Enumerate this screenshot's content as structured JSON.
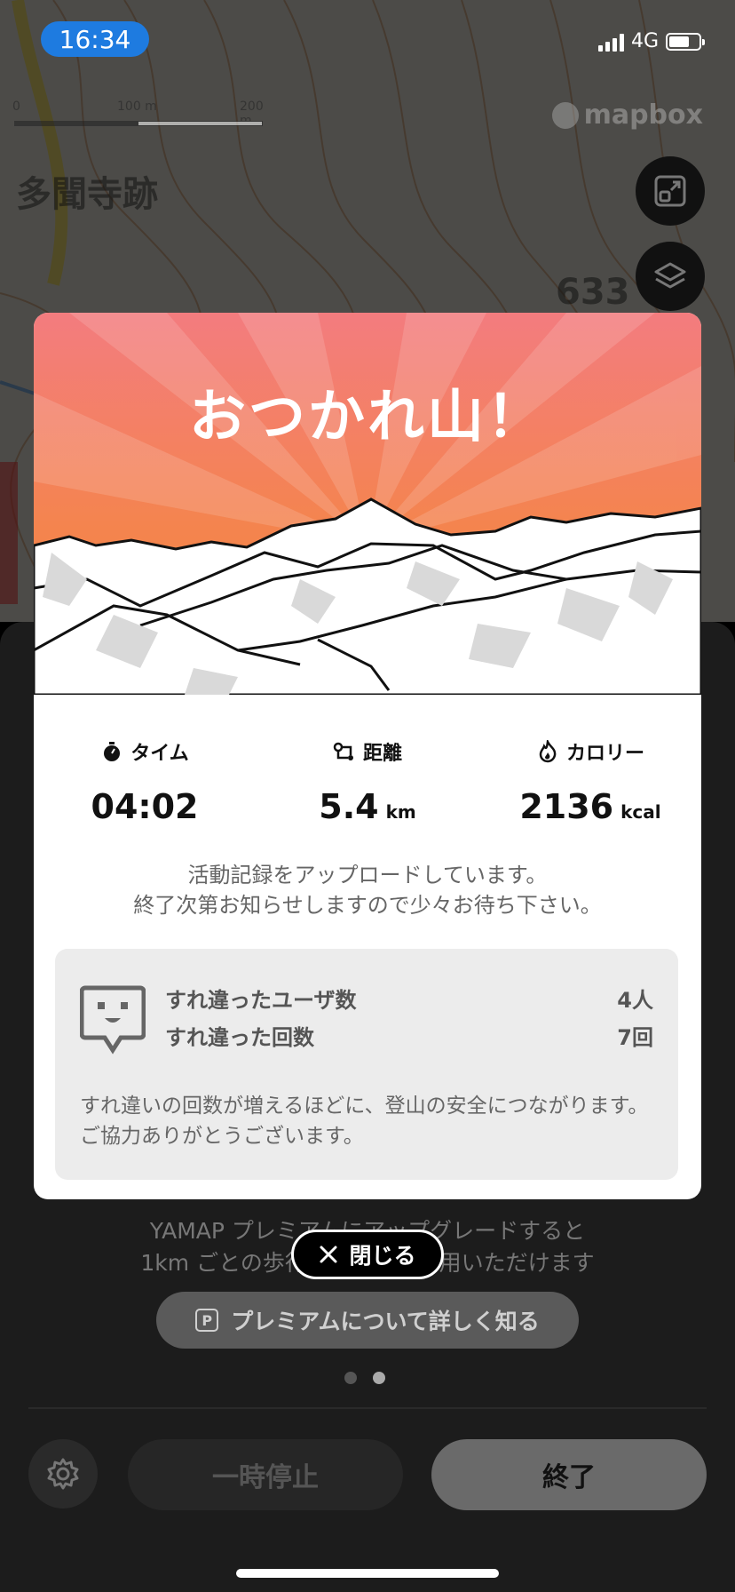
{
  "status_bar": {
    "time": "16:34",
    "network": "4G"
  },
  "map": {
    "scale_labels": [
      "0",
      "100 m",
      "200 m"
    ],
    "attribution": "mapbox",
    "place_name": "多聞寺跡",
    "elevation_label": "633"
  },
  "modal": {
    "title": "おつかれ山！",
    "stats": [
      {
        "icon": "stopwatch-icon",
        "label": "タイム",
        "value": "04:02",
        "unit": ""
      },
      {
        "icon": "route-icon",
        "label": "距離",
        "value": "5.4",
        "unit": "km"
      },
      {
        "icon": "flame-icon",
        "label": "カロリー",
        "value": "2136",
        "unit": "kcal"
      }
    ],
    "upload_message_1": "活動記録をアップロードしています。",
    "upload_message_2": "終了次第お知らせしますので少々お待ち下さい。",
    "encounter": {
      "users_label": "すれ違ったユーザ数",
      "users_value": "4人",
      "count_label": "すれ違った回数",
      "count_value": "7回",
      "note": "すれ違いの回数が増えるほどに、登山の安全につながります。ご協力ありがとうございます。"
    }
  },
  "close_button": "閉じる",
  "panel": {
    "promo_line_1": "YAMAP プレミアムにアップグレードすると",
    "promo_line_2": "1km ごとの歩行ペースがご利用いただけます",
    "premium_badge": "P",
    "premium_button": "プレミアムについて詳しく知る",
    "pause_button": "一時停止",
    "end_button": "終了"
  },
  "colors": {
    "hero_top": "#f47b7b",
    "hero_bottom": "#f5893a",
    "status_pill": "#1e7be0"
  }
}
